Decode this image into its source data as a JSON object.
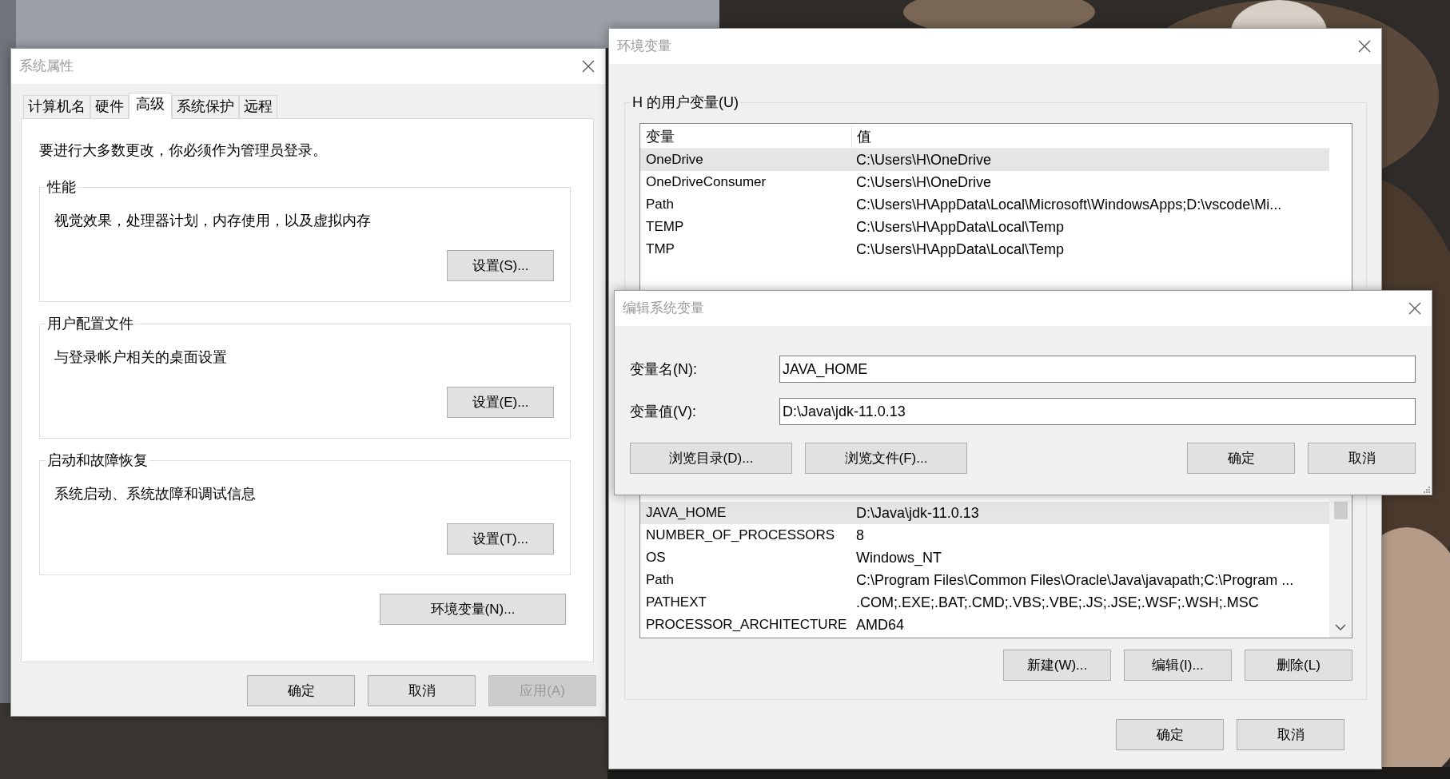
{
  "system_properties": {
    "title": "系统属性",
    "tabs": [
      {
        "label": "计算机名",
        "selected": false
      },
      {
        "label": "硬件",
        "selected": false
      },
      {
        "label": "高级",
        "selected": true
      },
      {
        "label": "系统保护",
        "selected": false
      },
      {
        "label": "远程",
        "selected": false
      }
    ],
    "notice": "要进行大多数更改，你必须作为管理员登录。",
    "groups": [
      {
        "title": "性能",
        "description": "视觉效果，处理器计划，内存使用，以及虚拟内存",
        "button": "设置(S)..."
      },
      {
        "title": "用户配置文件",
        "description": "与登录帐户相关的桌面设置",
        "button": "设置(E)..."
      },
      {
        "title": "启动和故障恢复",
        "description": "系统启动、系统故障和调试信息",
        "button": "设置(T)..."
      }
    ],
    "env_button": "环境变量(N)...",
    "buttons": [
      {
        "label": "确定",
        "disabled": false
      },
      {
        "label": "取消",
        "disabled": false
      },
      {
        "label": "应用(A)",
        "disabled": true
      }
    ]
  },
  "environment_variables": {
    "title": "环境变量",
    "user_group": "H 的用户变量(U)",
    "columns": [
      "变量",
      "值"
    ],
    "user_rows": [
      {
        "variable": "OneDrive",
        "value": "C:\\Users\\H\\OneDrive",
        "selected": true
      },
      {
        "variable": "OneDriveConsumer",
        "value": "C:\\Users\\H\\OneDrive",
        "selected": false
      },
      {
        "variable": "Path",
        "value": "C:\\Users\\H\\AppData\\Local\\Microsoft\\WindowsApps;D:\\vscode\\Mi...",
        "selected": false
      },
      {
        "variable": "TEMP",
        "value": "C:\\Users\\H\\AppData\\Local\\Temp",
        "selected": false
      },
      {
        "variable": "TMP",
        "value": "C:\\Users\\H\\AppData\\Local\\Temp",
        "selected": false
      }
    ],
    "system_rows": [
      {
        "variable": "JAVA_HOME",
        "value": "D:\\Java\\jdk-11.0.13",
        "selected": true
      },
      {
        "variable": "NUMBER_OF_PROCESSORS",
        "value": "8",
        "selected": false
      },
      {
        "variable": "OS",
        "value": "Windows_NT",
        "selected": false
      },
      {
        "variable": "Path",
        "value": "C:\\Program Files\\Common Files\\Oracle\\Java\\javapath;C:\\Program ...",
        "selected": false
      },
      {
        "variable": "PATHEXT",
        "value": ".COM;.EXE;.BAT;.CMD;.VBS;.VBE;.JS;.JSE;.WSF;.WSH;.MSC",
        "selected": false
      },
      {
        "variable": "PROCESSOR_ARCHITECTURE",
        "value": "AMD64",
        "selected": false
      }
    ],
    "system_buttons": [
      "新建(W)...",
      "编辑(I)...",
      "删除(L)"
    ],
    "buttons": [
      "确定",
      "取消"
    ]
  },
  "edit_dialog": {
    "title": "编辑系统变量",
    "fields": [
      {
        "label": "变量名(N):",
        "value": "JAVA_HOME"
      },
      {
        "label": "变量值(V):",
        "value": "D:\\Java\\jdk-11.0.13"
      }
    ],
    "browse_buttons": [
      "浏览目录(D)...",
      "浏览文件(F)..."
    ],
    "buttons": [
      "确定",
      "取消"
    ]
  }
}
